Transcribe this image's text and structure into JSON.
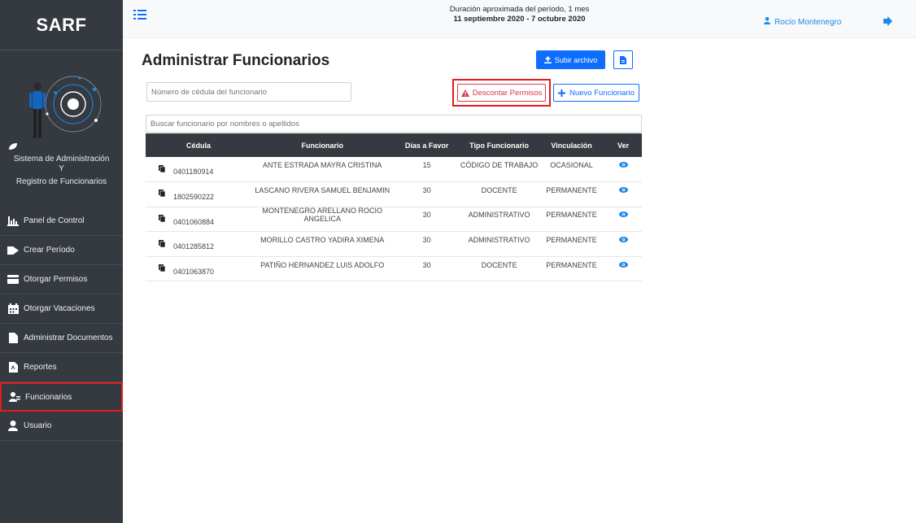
{
  "brand": "SARF",
  "app_description": [
    "Sistema de Administración",
    "Y",
    "Registro de Funcionarios"
  ],
  "menu": [
    {
      "label": "Panel de Control",
      "icon": "chart-icon"
    },
    {
      "label": "Crear Período",
      "icon": "tag-icon"
    },
    {
      "label": "Otorgar Permisos",
      "icon": "card-icon"
    },
    {
      "label": "Otorgar Vacaciones",
      "icon": "calendar-icon"
    },
    {
      "label": "Administrar Documentos",
      "icon": "file-icon"
    },
    {
      "label": "Reportes",
      "icon": "pdf-icon"
    },
    {
      "label": "Funcionarios",
      "icon": "users-icon",
      "active": true
    },
    {
      "label": "Usuario",
      "icon": "user-icon"
    }
  ],
  "topbar": {
    "period_line": "Duración aproximada del período, 1 mes",
    "period_range": "11 septiembre 2020 - 7 octubre 2020",
    "user_name": "Rocío Montenegro"
  },
  "main": {
    "title": "Administrar Funcionarios",
    "upload_label": "Subir archivo",
    "cedula_placeholder": "Número de cédula del funcionario",
    "descontar_label": "Descontar Permisos",
    "nuevo_label": "Nuevo Funcionario",
    "nombre_placeholder": "Buscar funcionario por nombres o apellidos"
  },
  "table": {
    "headers": [
      "Cédula",
      "Funcionario",
      "Días a Favor",
      "Tipo Funcionario",
      "Vinculación",
      "Ver"
    ],
    "rows": [
      {
        "cedula": "0401180914",
        "funcionario": "ANTE ESTRADA MAYRA CRISTINA",
        "dias": "15",
        "tipo": "CÓDIGO DE TRABAJO",
        "vinculacion": "OCASIONAL"
      },
      {
        "cedula": "1802590222",
        "funcionario": "LASCANO RIVERA SAMUEL BENJAMIN",
        "dias": "30",
        "tipo": "DOCENTE",
        "vinculacion": "PERMANENTE"
      },
      {
        "cedula": "0401060884",
        "funcionario": "MONTENEGRO ARELLANO ROCIO ANGELICA",
        "dias": "30",
        "tipo": "ADMINISTRATIVO",
        "vinculacion": "PERMANENTE"
      },
      {
        "cedula": "0401285812",
        "funcionario": "MORILLO CASTRO YADIRA XIMENA",
        "dias": "30",
        "tipo": "ADMINISTRATIVO",
        "vinculacion": "PERMANENTE"
      },
      {
        "cedula": "0401063870",
        "funcionario": "PATIÑO HERNANDEZ LUIS ADOLFO",
        "dias": "30",
        "tipo": "DOCENTE",
        "vinculacion": "PERMANENTE"
      }
    ]
  },
  "colors": {
    "sidebar": "#343a40",
    "primary": "#0d6efd",
    "danger": "#dc3545",
    "highlight": "#e21c1c"
  }
}
